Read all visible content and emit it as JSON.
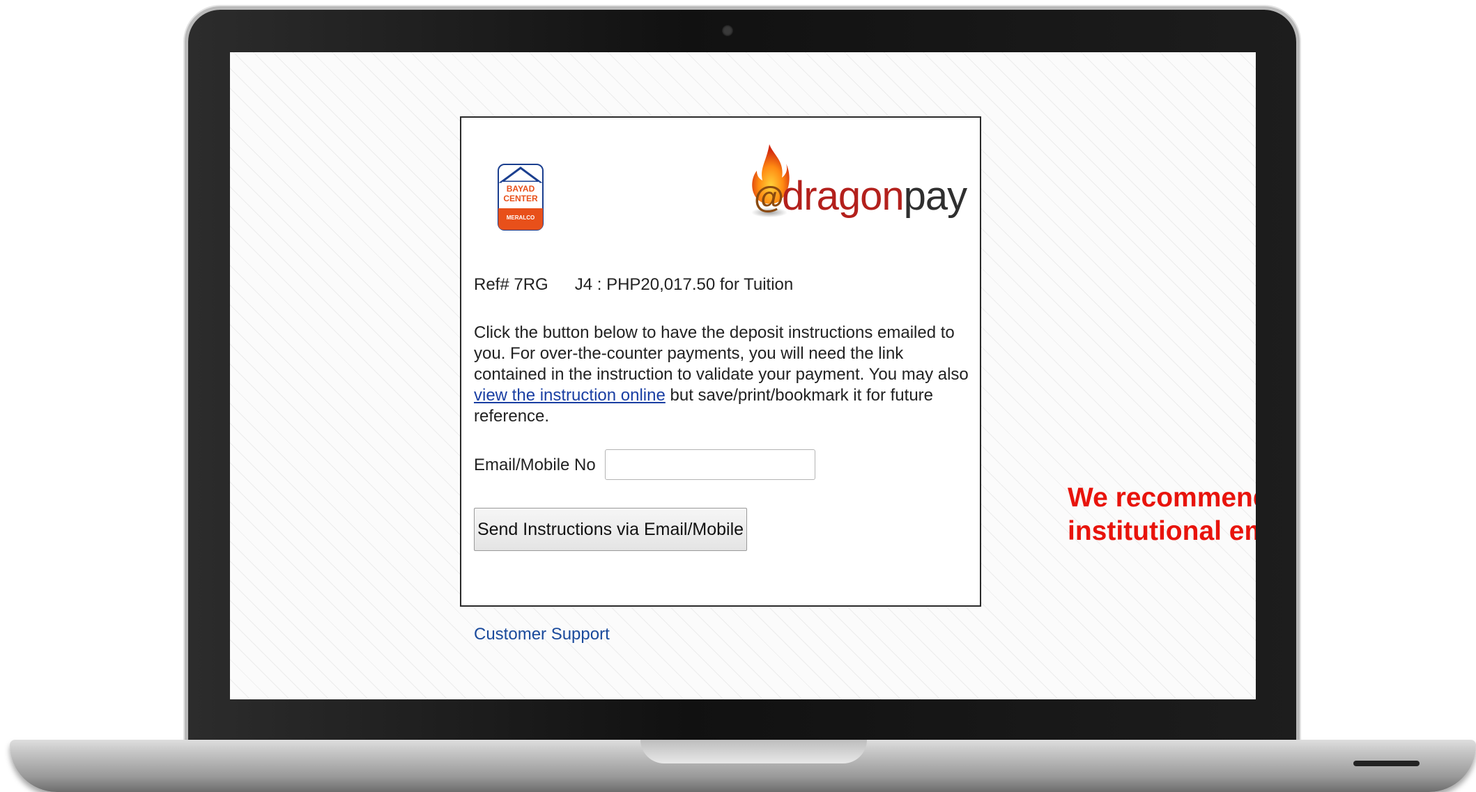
{
  "payment": {
    "ref_prefix": "Ref# 7RG",
    "ref_suffix": "J4 : PHP20,017.50 for Tuition",
    "instructions_part1": "Click the button below to have the deposit instructions emailed to you. For over-the-counter payments, you will need the link contained in the instruction to validate your payment. You may also ",
    "instructions_link": "view the instruction online",
    "instructions_part2": " but save/print/bookmark it for future reference.",
    "email_label": "Email/Mobile No",
    "email_value": "",
    "send_button_label": "Send Instructions via Email/Mobile",
    "support_link": "Customer Support"
  },
  "logos": {
    "bayad_line1": "BAYAD",
    "bayad_line2": "CENTER",
    "bayad_sub": "MERALCO",
    "dragonpay_at": "@",
    "dragonpay_dragon": "dragon",
    "dragonpay_pay": "pay"
  },
  "callout": {
    "text": "We recommend to input your institutional email address."
  },
  "colors": {
    "callout": "#e8140c",
    "link": "#1a3fa3",
    "bayad_blue": "#1b3f8f",
    "bayad_orange": "#e8501a",
    "dragon_red": "#b3201c"
  }
}
